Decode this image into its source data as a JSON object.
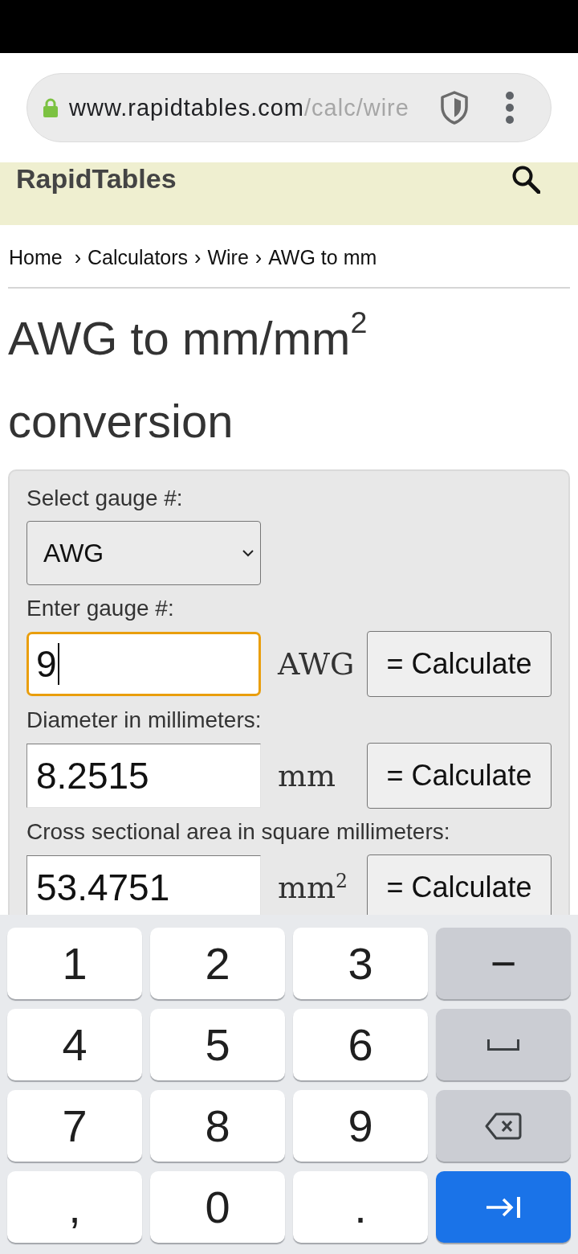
{
  "browser": {
    "url": {
      "host": "www.rapidtables.com",
      "path": "/calc/wire"
    }
  },
  "site_header": {
    "logo": "RapidTables"
  },
  "breadcrumb": {
    "separator": "›",
    "items": [
      "Home",
      "Calculators",
      "Wire",
      "AWG to mm"
    ]
  },
  "title": "AWG to mm/mm$^{2}$ conversion",
  "calculator": {
    "rows": [
      {
        "kind": "select",
        "label": "Select gauge #:",
        "value": "AWG"
      },
      {
        "kind": "input",
        "label": "Enter gauge #:",
        "value": "9",
        "focused": true,
        "unit": "AWG",
        "button": "= Calculate"
      },
      {
        "kind": "input",
        "label": "Diameter in millimeters:",
        "value": "8.2515",
        "focused": false,
        "unit": "mm",
        "button": "= Calculate"
      },
      {
        "kind": "input",
        "label": "Cross sectional area in square millimeters:",
        "value": "53.4751",
        "focused": false,
        "unit": "mm$^{2}$",
        "button": "= Calculate"
      }
    ]
  },
  "keyboard": {
    "keys": [
      {
        "kind": "char",
        "label": "1"
      },
      {
        "kind": "char",
        "label": "2"
      },
      {
        "kind": "char",
        "label": "3"
      },
      {
        "kind": "symbol",
        "label": "−"
      },
      {
        "kind": "char",
        "label": "4"
      },
      {
        "kind": "char",
        "label": "5"
      },
      {
        "kind": "char",
        "label": "6"
      },
      {
        "kind": "space"
      },
      {
        "kind": "char",
        "label": "7"
      },
      {
        "kind": "char",
        "label": "8"
      },
      {
        "kind": "char",
        "label": "9"
      },
      {
        "kind": "backspace"
      },
      {
        "kind": "char",
        "label": ","
      },
      {
        "kind": "char",
        "label": "0"
      },
      {
        "kind": "char",
        "label": "."
      },
      {
        "kind": "next"
      }
    ]
  }
}
